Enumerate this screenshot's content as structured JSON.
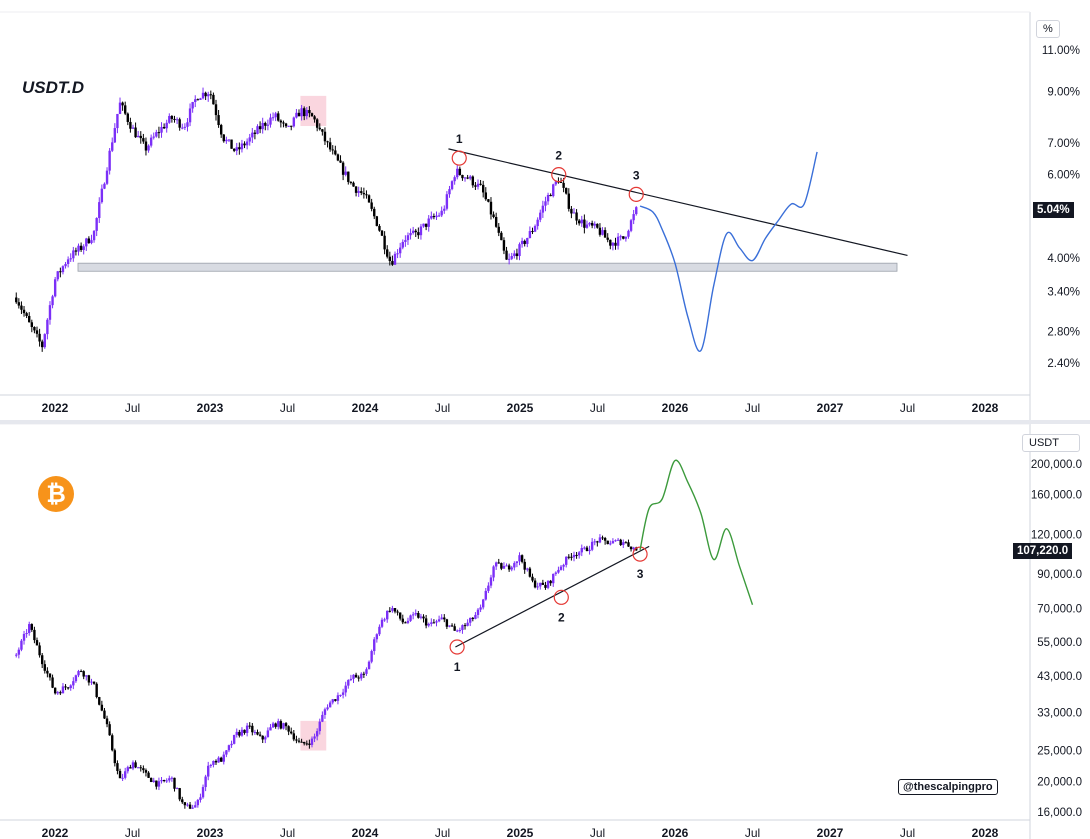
{
  "top_pane": {
    "symbol": "USDT.D",
    "unit": "%",
    "last_value_label": "5.04%",
    "y_tick_labels": [
      "11.00%",
      "9.00%",
      "7.00%",
      "6.00%",
      "5.04%",
      "4.00%",
      "3.40%",
      "2.80%",
      "2.40%"
    ],
    "x_tick_labels": [
      "2022",
      "Jul",
      "2023",
      "Jul",
      "2024",
      "Jul",
      "2025",
      "Jul",
      "2026",
      "Jul",
      "2027",
      "Jul",
      "2028"
    ],
    "touch_labels": [
      "1",
      "2",
      "3"
    ]
  },
  "bottom_pane": {
    "unit": "USDT",
    "last_value_label": "107,220.0",
    "logo_glyph": "₿",
    "watermark": "@thescalpingpro",
    "y_tick_labels": [
      "200,000.0",
      "160,000.0",
      "120,000.0",
      "90,000.0",
      "70,000.0",
      "55,000.0",
      "43,000.0",
      "33,000.0",
      "25,000.0",
      "20,000.0",
      "16,000.0"
    ],
    "x_tick_labels": [
      "2022",
      "Jul",
      "2023",
      "Jul",
      "2024",
      "Jul",
      "2025",
      "Jul",
      "2026",
      "Jul",
      "2027",
      "Jul",
      "2028"
    ],
    "touch_labels": [
      "1",
      "2",
      "3"
    ]
  },
  "colors": {
    "candle_up": "#7b2ff7",
    "candle_down": "#000000",
    "projection_usdt": "#3a6fd8",
    "projection_btc": "#3c9a3c",
    "touch_circle": "#e53935",
    "support_zone": "#d8dbe2",
    "highlight_box": "#f8c8d4",
    "btc_orange": "#f7931a"
  },
  "chart_data": [
    {
      "type": "candlestick",
      "title": "USDT.D",
      "y_unit": "%",
      "y_scale": "log",
      "ylim": [
        2.2,
        12.0
      ],
      "xlim": [
        "2021-10",
        "2028-03"
      ],
      "path": [
        [
          "2021-10-01",
          3.3
        ],
        [
          "2021-11-01",
          2.9
        ],
        [
          "2021-12-01",
          2.6
        ],
        [
          "2022-01-01",
          3.6
        ],
        [
          "2022-02-01",
          4.0
        ],
        [
          "2022-03-01",
          4.2
        ],
        [
          "2022-04-01",
          4.5
        ],
        [
          "2022-05-01",
          6.2
        ],
        [
          "2022-06-01",
          8.5
        ],
        [
          "2022-07-01",
          7.5
        ],
        [
          "2022-08-01",
          6.8
        ],
        [
          "2022-09-01",
          7.4
        ],
        [
          "2022-10-01",
          7.9
        ],
        [
          "2022-11-01",
          7.6
        ],
        [
          "2022-12-01",
          8.8
        ],
        [
          "2023-01-01",
          9.0
        ],
        [
          "2023-02-01",
          7.2
        ],
        [
          "2023-03-01",
          6.7
        ],
        [
          "2023-04-01",
          7.1
        ],
        [
          "2023-05-01",
          7.6
        ],
        [
          "2023-06-01",
          8.0
        ],
        [
          "2023-07-01",
          7.4
        ],
        [
          "2023-08-01",
          8.2
        ],
        [
          "2023-09-01",
          7.9
        ],
        [
          "2023-10-01",
          7.0
        ],
        [
          "2023-11-01",
          6.3
        ],
        [
          "2023-12-01",
          5.7
        ],
        [
          "2024-01-01",
          5.4
        ],
        [
          "2024-02-01",
          4.7
        ],
        [
          "2024-03-01",
          3.9
        ],
        [
          "2024-04-01",
          4.4
        ],
        [
          "2024-05-01",
          4.5
        ],
        [
          "2024-06-01",
          4.8
        ],
        [
          "2024-07-01",
          5.0
        ],
        [
          "2024-08-01",
          6.1
        ],
        [
          "2024-09-01",
          5.9
        ],
        [
          "2024-10-01",
          5.6
        ],
        [
          "2024-11-01",
          4.8
        ],
        [
          "2024-12-01",
          3.9
        ],
        [
          "2025-01-01",
          4.2
        ],
        [
          "2025-02-01",
          4.6
        ],
        [
          "2025-03-01",
          5.3
        ],
        [
          "2025-04-01",
          5.9
        ],
        [
          "2025-05-01",
          5.0
        ],
        [
          "2025-06-01",
          4.7
        ],
        [
          "2025-07-01",
          4.6
        ],
        [
          "2025-08-01",
          4.3
        ],
        [
          "2025-09-01",
          4.4
        ],
        [
          "2025-10-01",
          5.04
        ]
      ],
      "annotations": {
        "descending_trendline": [
          [
            "2024-07-15",
            6.8
          ],
          [
            "2027-07-01",
            4.05
          ]
        ],
        "touch_points": [
          {
            "label": "1",
            "date": "2024-08-10",
            "value": 6.5
          },
          {
            "label": "2",
            "date": "2025-04-01",
            "value": 6.0
          },
          {
            "label": "3",
            "date": "2025-10-01",
            "value": 5.45
          }
        ],
        "support_zone": {
          "from": "2022-01-01",
          "to": "2027-12-01",
          "low": 3.75,
          "high": 3.9
        },
        "highlight_box": {
          "from": "2023-08-01",
          "to": "2023-10-01",
          "low": 7.6,
          "high": 8.8
        },
        "projection": [
          [
            "2025-10-10",
            5.15
          ],
          [
            "2025-11-10",
            5.0
          ],
          [
            "2025-12-01",
            4.6
          ],
          [
            "2026-01-01",
            3.9
          ],
          [
            "2026-02-01",
            3.0
          ],
          [
            "2026-03-01",
            2.55
          ],
          [
            "2026-04-01",
            3.5
          ],
          [
            "2026-05-01",
            4.5
          ],
          [
            "2026-06-01",
            4.2
          ],
          [
            "2026-07-01",
            3.95
          ],
          [
            "2026-08-01",
            4.4
          ],
          [
            "2026-09-01",
            4.8
          ],
          [
            "2026-10-01",
            5.2
          ],
          [
            "2026-11-01",
            5.2
          ],
          [
            "2026-12-01",
            6.7
          ]
        ]
      }
    },
    {
      "type": "candlestick",
      "title": "",
      "y_unit": "USDT",
      "y_scale": "log",
      "ylim": [
        15500,
        220000
      ],
      "xlim": [
        "2021-10",
        "2028-03"
      ],
      "path": [
        [
          "2021-10-01",
          50000
        ],
        [
          "2021-11-01",
          62000
        ],
        [
          "2021-12-01",
          48000
        ],
        [
          "2022-01-01",
          38000
        ],
        [
          "2022-02-01",
          40000
        ],
        [
          "2022-03-01",
          45000
        ],
        [
          "2022-04-01",
          40000
        ],
        [
          "2022-05-01",
          30000
        ],
        [
          "2022-06-01",
          20000
        ],
        [
          "2022-07-01",
          23000
        ],
        [
          "2022-08-01",
          21000
        ],
        [
          "2022-09-01",
          19500
        ],
        [
          "2022-10-01",
          20500
        ],
        [
          "2022-11-01",
          16500
        ],
        [
          "2022-12-01",
          16800
        ],
        [
          "2023-01-01",
          23000
        ],
        [
          "2023-02-01",
          23500
        ],
        [
          "2023-03-01",
          28000
        ],
        [
          "2023-04-01",
          29500
        ],
        [
          "2023-05-01",
          27000
        ],
        [
          "2023-06-01",
          30500
        ],
        [
          "2023-07-01",
          29500
        ],
        [
          "2023-08-01",
          26000
        ],
        [
          "2023-09-01",
          27000
        ],
        [
          "2023-10-01",
          34500
        ],
        [
          "2023-11-01",
          37500
        ],
        [
          "2023-12-01",
          42500
        ],
        [
          "2024-01-01",
          43000
        ],
        [
          "2024-02-01",
          61000
        ],
        [
          "2024-03-01",
          71000
        ],
        [
          "2024-04-01",
          63000
        ],
        [
          "2024-05-01",
          67000
        ],
        [
          "2024-06-01",
          62000
        ],
        [
          "2024-07-01",
          65000
        ],
        [
          "2024-08-01",
          59000
        ],
        [
          "2024-09-01",
          63000
        ],
        [
          "2024-10-01",
          70000
        ],
        [
          "2024-11-01",
          96000
        ],
        [
          "2024-12-01",
          94000
        ],
        [
          "2025-01-01",
          102000
        ],
        [
          "2025-02-01",
          84000
        ],
        [
          "2025-03-01",
          82000
        ],
        [
          "2025-04-01",
          94000
        ],
        [
          "2025-05-01",
          104000
        ],
        [
          "2025-06-01",
          107000
        ],
        [
          "2025-07-01",
          115000
        ],
        [
          "2025-08-01",
          113000
        ],
        [
          "2025-09-01",
          114000
        ],
        [
          "2025-10-01",
          107220
        ]
      ],
      "annotations": {
        "ascending_trendline": [
          [
            "2024-08-01",
            53000
          ],
          [
            "2025-11-01",
            110000
          ]
        ],
        "touch_points": [
          {
            "label": "1",
            "date": "2024-08-05",
            "value": 53000
          },
          {
            "label": "2",
            "date": "2025-04-07",
            "value": 76000
          },
          {
            "label": "3",
            "date": "2025-10-10",
            "value": 104000
          }
        ],
        "highlight_box": {
          "from": "2023-08-01",
          "to": "2023-10-01",
          "low": 25000,
          "high": 31000
        },
        "projection": [
          [
            "2025-10-10",
            107220
          ],
          [
            "2025-11-01",
            145000
          ],
          [
            "2025-12-01",
            155000
          ],
          [
            "2026-01-01",
            205000
          ],
          [
            "2026-02-01",
            175000
          ],
          [
            "2026-03-01",
            140000
          ],
          [
            "2026-04-01",
            100000
          ],
          [
            "2026-05-01",
            125000
          ],
          [
            "2026-06-01",
            95000
          ],
          [
            "2026-07-01",
            72000
          ]
        ]
      }
    }
  ]
}
